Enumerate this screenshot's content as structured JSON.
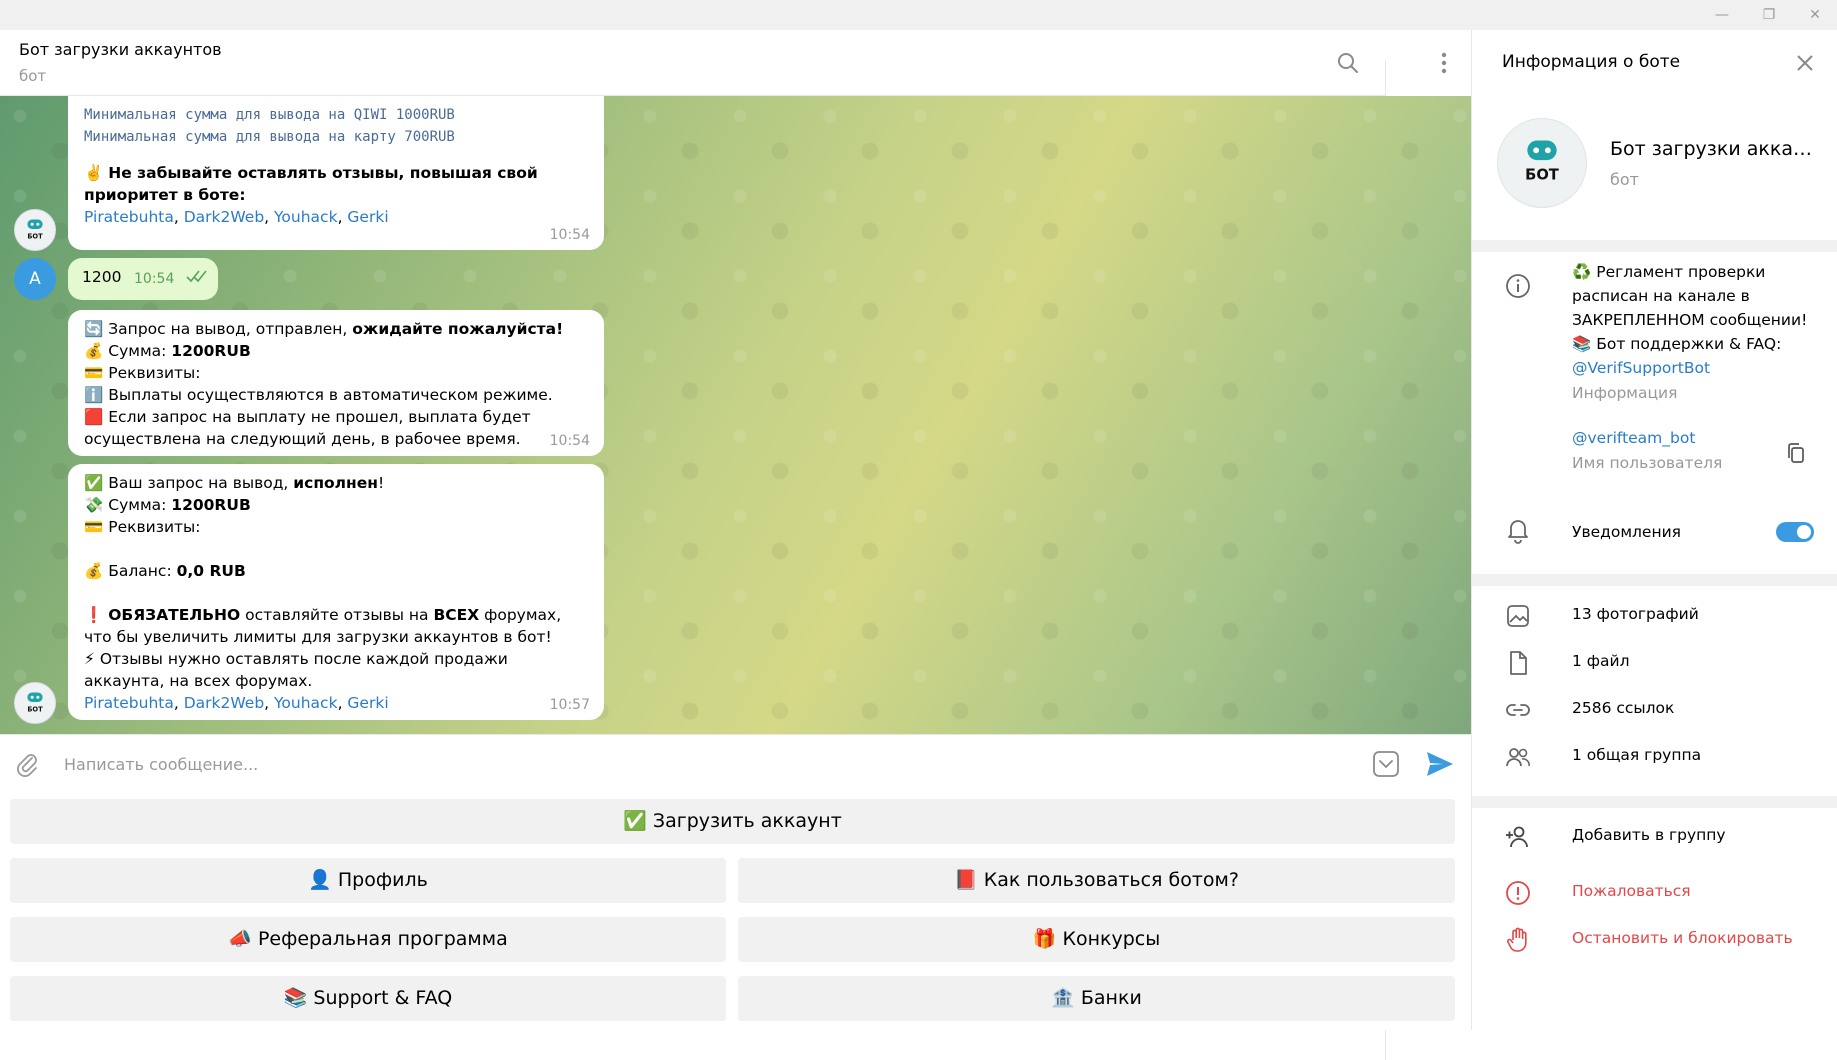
{
  "window": {
    "minimize_glyph": "—",
    "maximize_glyph": "❐",
    "close_glyph": "✕"
  },
  "header": {
    "title": "Бот загрузки аккаунтов",
    "status": "бот"
  },
  "messages": {
    "m1": {
      "line1": "Минимальная сумма для вывода на QIWI 1000RUB",
      "line2": "Минимальная сумма для вывода на карту 700RUB",
      "emoji": "✌️",
      "bold_text": "Не забывайте оставлять отзывы, повышая свой приоритет в боте:",
      "links": [
        "Piratebuhta",
        "Dark2Web",
        "Youhack",
        "Gerki"
      ],
      "comma": ", ",
      "time": "10:54"
    },
    "user_msg": {
      "avatar_letter": "A",
      "text": "1200",
      "time": "10:54"
    },
    "m2": {
      "l1_emoji": "🔄",
      "l1_text": "Запрос на вывод,  отправлен, ",
      "l1_bold": "ожидайте пожалуйста!",
      "l2_emoji": "💰",
      "l2_text": "Сумма: ",
      "l2_bold": "1200RUB",
      "l3_emoji": "💳",
      "l3_text": "Реквизиты:",
      "l4_emoji": "ℹ️",
      "l4_text": "Выплаты осуществляются в автоматическом режиме.",
      "l5_emoji": "🟥",
      "l5_text": "Если запрос на выплату не прошел, выплата будет осуществлена на следующий день, в рабочее время.",
      "time": "10:54"
    },
    "m3": {
      "l1_emoji": "✅",
      "l1_text": "Ваш запрос на вывод, ",
      "l1_bold": "исполнен",
      "l1_tail": "!",
      "l2_emoji": "💸",
      "l2_text": "Сумма: ",
      "l2_bold": "1200RUB",
      "l3_emoji": "💳",
      "l3_text": "Реквизиты:",
      "l4_emoji": "💰",
      "l4_text": "Баланс: ",
      "l4_bold": "0,0 RUB",
      "l5_emoji": "❗",
      "l5_bold1": "ОБЯЗАТЕЛЬНО",
      "l5_text1": " оставляйте отзывы на ",
      "l5_bold2": "ВСЕХ",
      "l5_text2": " форумах, что бы увеличить лимиты для загрузки аккаунтов в бот!",
      "l6_emoji": "⚡",
      "l6_text": "Отзывы нужно оставлять после каждой продажи аккаунта, на всех форумах.",
      "links": [
        "Piratebuhta",
        "Dark2Web",
        "Youhack",
        "Gerki"
      ],
      "time": "10:57"
    }
  },
  "composer": {
    "placeholder": "Написать сообщение..."
  },
  "keyboard": {
    "upload": "✅ Загрузить аккаунт",
    "profile": "👤 Профиль",
    "howto": "📕 Как пользоваться ботом?",
    "referral": "📣 Реферальная программа",
    "contests": "🎁 Конкурсы",
    "support": "📚 Support & FAQ",
    "banks": "🏦 Банки"
  },
  "panel": {
    "title": "Информация о боте",
    "name": "Бот загрузки аккаунтов",
    "subtitle": "бот",
    "info_lines": [
      "♻️ Регламент проверки",
      "расписан на канале в",
      "ЗАКРЕПЛЕННОМ сообщении!",
      "📚 Бот поддержки & FAQ:"
    ],
    "info_link": "@VerifSupportBot",
    "info_label": "Информация",
    "username": "@verifteam_bot",
    "username_label": "Имя пользователя",
    "notifications": "Уведомления",
    "photos": "13 фотографий",
    "files": "1 файл",
    "links": "2586 ссылок",
    "groups": "1 общая группа",
    "add_group": "Добавить в группу",
    "report": "Пожаловаться",
    "block": "Остановить и блокировать"
  },
  "colors": {
    "accent": "#3b9be0",
    "link": "#2a7bc9",
    "danger": "#e0484a",
    "outgoing_bubble": "#e4f9cf"
  }
}
